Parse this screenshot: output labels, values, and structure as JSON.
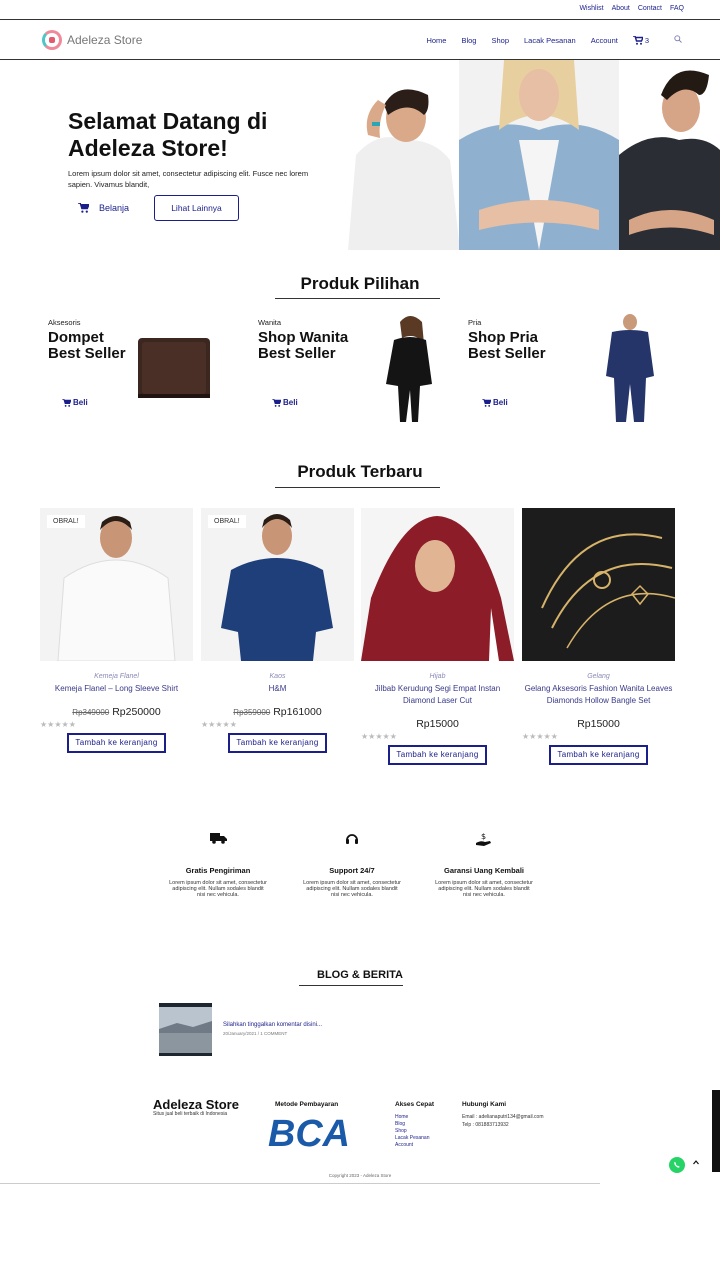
{
  "topbar": {
    "links": [
      "Wishlist",
      "About",
      "Contact",
      "FAQ"
    ]
  },
  "header": {
    "logo_text": "Adeleza Store",
    "nav": [
      "Home",
      "Blog",
      "Shop",
      "Lacak Pesanan",
      "Account"
    ],
    "cart_count": "3"
  },
  "hero": {
    "title_line1": "Selamat Datang di",
    "title_line2": "Adeleza Store!",
    "text": "Lorem ipsum dolor sit amet, consectetur adipiscing elit. Fusce nec lorem sapien. Vivamus blandit,",
    "btn_primary": "Belanja",
    "btn_secondary": "Lihat Lainnya"
  },
  "featured": {
    "title": "Produk Pilihan",
    "items": [
      {
        "category": "Aksesoris",
        "name_line1": "Dompet",
        "name_line2": "Best Seller",
        "buy": "Beli"
      },
      {
        "category": "Wanita",
        "name_line1": "Shop Wanita",
        "name_line2": "Best Seller",
        "buy": "Beli"
      },
      {
        "category": "Pria",
        "name_line1": "Shop Pria",
        "name_line2": "Best Seller",
        "buy": "Beli"
      }
    ]
  },
  "latest": {
    "title": "Produk Terbaru",
    "badge": "OBRAL!",
    "add_to_cart": "Tambah ke keranjang",
    "rating": "★★★★★",
    "products": [
      {
        "category": "Kemeja Flanel",
        "name": "Kemeja Flanel – Long Sleeve Shirt",
        "old_price": "Rp349000",
        "price": "Rp250000"
      },
      {
        "category": "Kaos",
        "name": "H&M",
        "old_price": "Rp359000",
        "price": "Rp161000"
      },
      {
        "category": "Hijab",
        "name": "Jilbab Kerudung Segi Empat Instan Diamond Laser Cut",
        "old_price": "",
        "price": "Rp15000"
      },
      {
        "category": "Gelang",
        "name": "Gelang Aksesoris Fashion Wanita Leaves Diamonds Hollow Bangle Set",
        "old_price": "",
        "price": "Rp15000"
      }
    ]
  },
  "features": [
    {
      "icon": "truck-icon",
      "title": "Gratis Pengiriman",
      "text": "Lorem ipsum dolor sit amet, consectetur adipiscing elit. Nullam sodales blandit nisi nec vehicula."
    },
    {
      "icon": "headset-icon",
      "title": "Support 24/7",
      "text": "Lorem ipsum dolor sit amet, consectetur adipiscing elit. Nullam sodales blandit nisi nec vehicula."
    },
    {
      "icon": "money-hand-icon",
      "title": "Garansi Uang Kembali",
      "text": "Lorem ipsum dolor sit amet, consectetur adipiscing elit. Nullam sodales blandit nisi nec vehicula."
    }
  ],
  "blog": {
    "title": "BLOG & BERITA",
    "post_link": "Silahkan tinggalkan komentar disini...",
    "post_meta": "20/January/2021 / 1 COMMENT"
  },
  "footer": {
    "brand": "Adeleza Store",
    "tagline": "Situs jual beli terbaik di Indonesia",
    "payment_title": "Metode Pembayaran",
    "payment_logo": "BCA",
    "quick_title": "Akses Cepat",
    "quick_links": [
      "Home",
      "Blog",
      "Shop",
      "Lacak Pesanan",
      "Account"
    ],
    "contact_title": "Hubungi Kami",
    "email": "Email : adelianaputri134@gmail.com",
    "phone": "Telp : 081883713932",
    "copyright": "Copyright 2023 - Adeleza Store"
  },
  "colors": {
    "accent": "#1b1f8a",
    "whatsapp": "#25d366"
  }
}
